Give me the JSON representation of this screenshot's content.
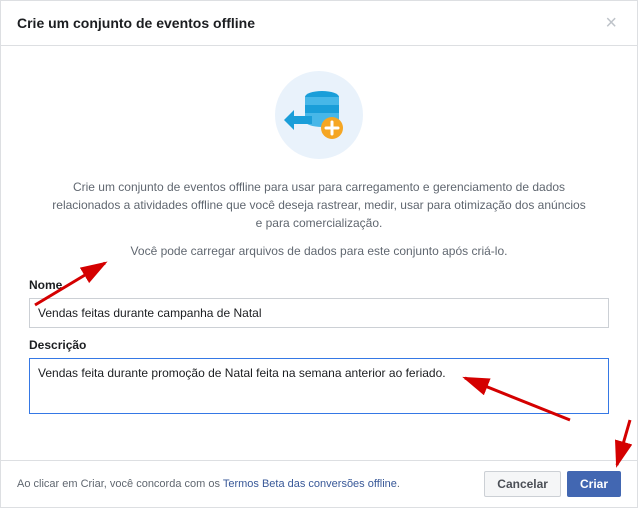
{
  "header": {
    "title": "Crie um conjunto de eventos offline"
  },
  "body": {
    "description1": "Crie um conjunto de eventos offline para usar para carregamento e gerenciamento de dados relacionados a atividades offline que você deseja rastrear, medir, usar para otimização dos anúncios e para comercialização.",
    "description2": "Você pode carregar arquivos de dados para este conjunto após criá-lo.",
    "nameLabel": "Nome",
    "nameValue": "Vendas feitas durante campanha de Natal",
    "descLabel": "Descrição",
    "descValue": "Vendas feita durante promoção de Natal feita na semana anterior ao feriado."
  },
  "footer": {
    "agreePrefix": "Ao clicar em Criar, você concorda com os ",
    "termsLink": "Termos Beta das conversões offline",
    "agreeSuffix": ".",
    "cancelLabel": "Cancelar",
    "createLabel": "Criar"
  }
}
